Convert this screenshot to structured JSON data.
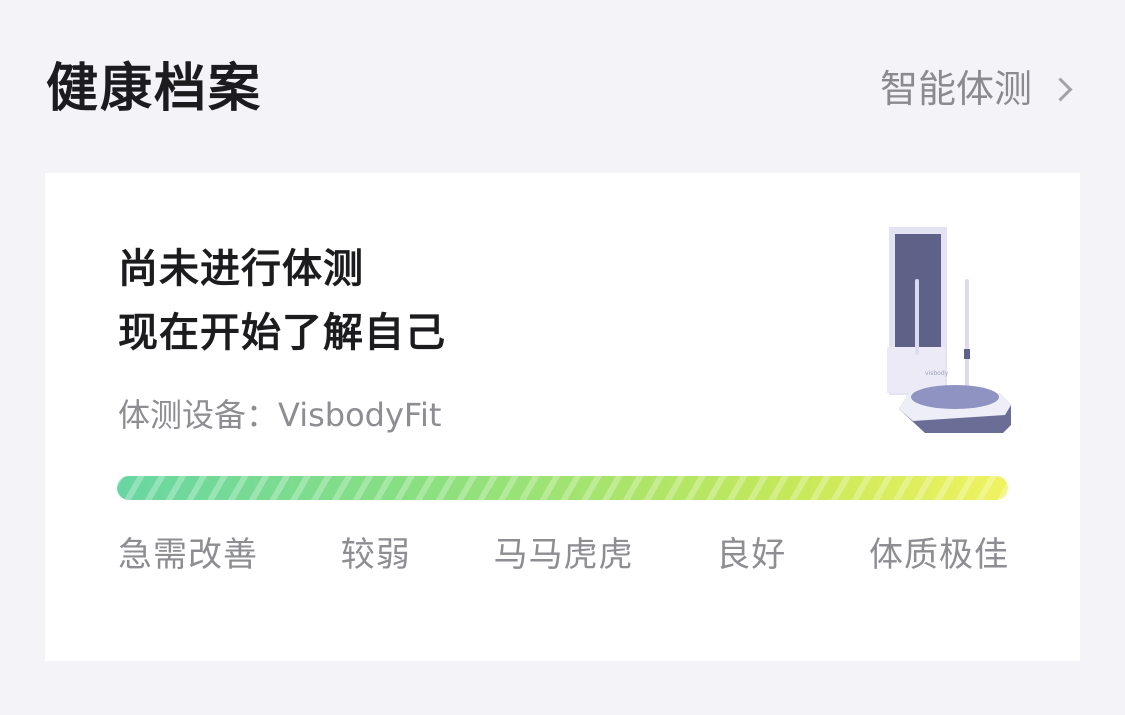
{
  "header": {
    "title": "健康档案",
    "link_label": "智能体测"
  },
  "card": {
    "headline_line1": "尚未进行体测",
    "headline_line2": "现在开始了解自己",
    "device_label": "体测设备：",
    "device_name": "VisbodyFit",
    "illustration_brand": "visbody",
    "levels": [
      "急需改善",
      "较弱",
      "马马虎虎",
      "良好",
      "体质极佳"
    ]
  },
  "colors": {
    "background": "#f4f4f8",
    "card": "#ffffff",
    "bar_start": "#68d6a3",
    "bar_end": "#f1f360",
    "device_body": "#5e6288"
  }
}
